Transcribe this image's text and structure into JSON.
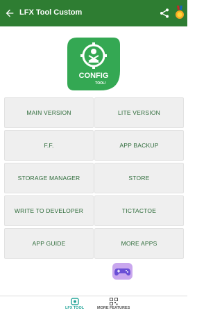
{
  "header": {
    "title": "LFX Tool Custom"
  },
  "logo": {
    "line1": "CONFIG",
    "line2": "TOOL!"
  },
  "buttons": {
    "main_version": "MAIN VERSION",
    "lite_version": "LITE VERSION",
    "ff": "F.F.",
    "app_backup": "APP BACKUP",
    "storage_manager": "STORAGE MANAGER",
    "store": "STORE",
    "write_to_developer": "WRITE TO DEVELOPER",
    "tictactoe": "TICTACTOE",
    "app_guide": "APP GUIDE",
    "more_apps": "MORE APPS"
  },
  "bottom_nav": {
    "tab1": "LFX TOOL",
    "tab2": "MORE FEATURES"
  },
  "colors": {
    "primary": "#2e7d32",
    "logo_green": "#34a853",
    "button_text": "#2e6b3a",
    "active_tab": "#26a69a",
    "inactive_tab": "#555555"
  },
  "icons": {
    "back": "arrow-left",
    "share": "share",
    "award": "award-medal",
    "game": "gamepad",
    "tab1": "lfx-tool",
    "tab2": "qr-code"
  }
}
